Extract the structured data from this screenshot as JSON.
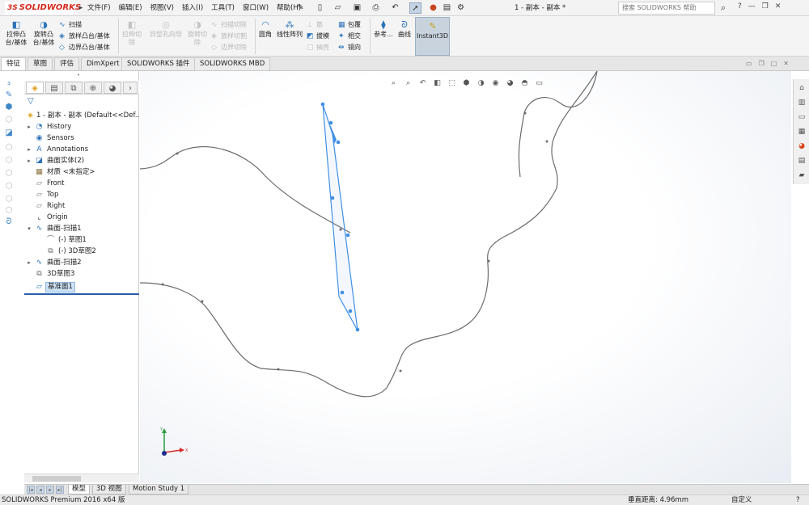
{
  "titlebar": {
    "logo": "SOLIDWORKS",
    "menus": [
      "文件(F)",
      "编辑(E)",
      "视图(V)",
      "插入(I)",
      "工具(T)",
      "窗口(W)",
      "帮助(H)"
    ],
    "document_title": "1 - 副本 - 副本 *",
    "search_placeholder": "搜索 SOLIDWORKS 帮助"
  },
  "ribbon": {
    "extrude_boss": "拉伸凸\n台/基体",
    "revolve_boss": "旋转凸\n台/基体",
    "sweep": "扫描",
    "loft_boss": "放样凸台/基体",
    "boundary_boss": "边界凸台/基体",
    "extrude_cut": "拉伸切\n除",
    "hole_wizard": "异型孔向导",
    "revolve_cut": "旋转切\n除",
    "swept_cut": "扫描切除",
    "lofted_cut": "放样切割",
    "boundary_cut": "边界切除",
    "fillet": "圆角",
    "linear_pattern": "线性阵列",
    "rib": "筋",
    "draft": "拔模",
    "shell": "抽壳",
    "wrap": "包覆",
    "intersect": "相交",
    "mirror": "镜向",
    "reference": "参考...",
    "curves": "曲线",
    "instant3d": "Instant3D"
  },
  "tabs": [
    "特征",
    "草图",
    "评估",
    "DimXpert",
    "SOLIDWORKS 插件",
    "SOLIDWORKS MBD"
  ],
  "tree": {
    "root": "1 - 副本 - 副本  (Default<<Def...",
    "items": [
      {
        "label": "History",
        "icon": "history-icon"
      },
      {
        "label": "Sensors",
        "icon": "sensors-icon"
      },
      {
        "label": "Annotations",
        "icon": "annotations-icon"
      },
      {
        "label": "曲面实体(2)",
        "icon": "surface-bodies-icon"
      },
      {
        "label": "材质 <未指定>",
        "icon": "material-icon"
      },
      {
        "label": "Front",
        "icon": "plane-icon"
      },
      {
        "label": "Top",
        "icon": "plane-icon"
      },
      {
        "label": "Right",
        "icon": "plane-icon"
      },
      {
        "label": "Origin",
        "icon": "origin-icon"
      },
      {
        "label": "曲面-扫描1",
        "icon": "surface-sweep-icon"
      },
      {
        "label": "(-) 草图1",
        "icon": "sketch-icon"
      },
      {
        "label": "(-) 3D草图2",
        "icon": "3d-sketch-icon"
      },
      {
        "label": "曲面-扫描2",
        "icon": "surface-sweep-icon"
      },
      {
        "label": "3D草图3",
        "icon": "3d-sketch-icon"
      },
      {
        "label": "基准面1",
        "icon": "plane-icon"
      }
    ]
  },
  "bottom_tabs": [
    "模型",
    "3D 视图",
    "Motion Study 1"
  ],
  "status": {
    "product": "SOLIDWORKS Premium 2016 x64 版",
    "distance": "垂直距离: 4.96mm",
    "units": "自定义",
    "help": "?"
  },
  "triad": {
    "x": "X",
    "y": "Y"
  },
  "colors": {
    "accent": "#2d73b8",
    "brand": "#d52b1e",
    "selection": "#3f8fe6",
    "curve": "#6b6b6b"
  }
}
